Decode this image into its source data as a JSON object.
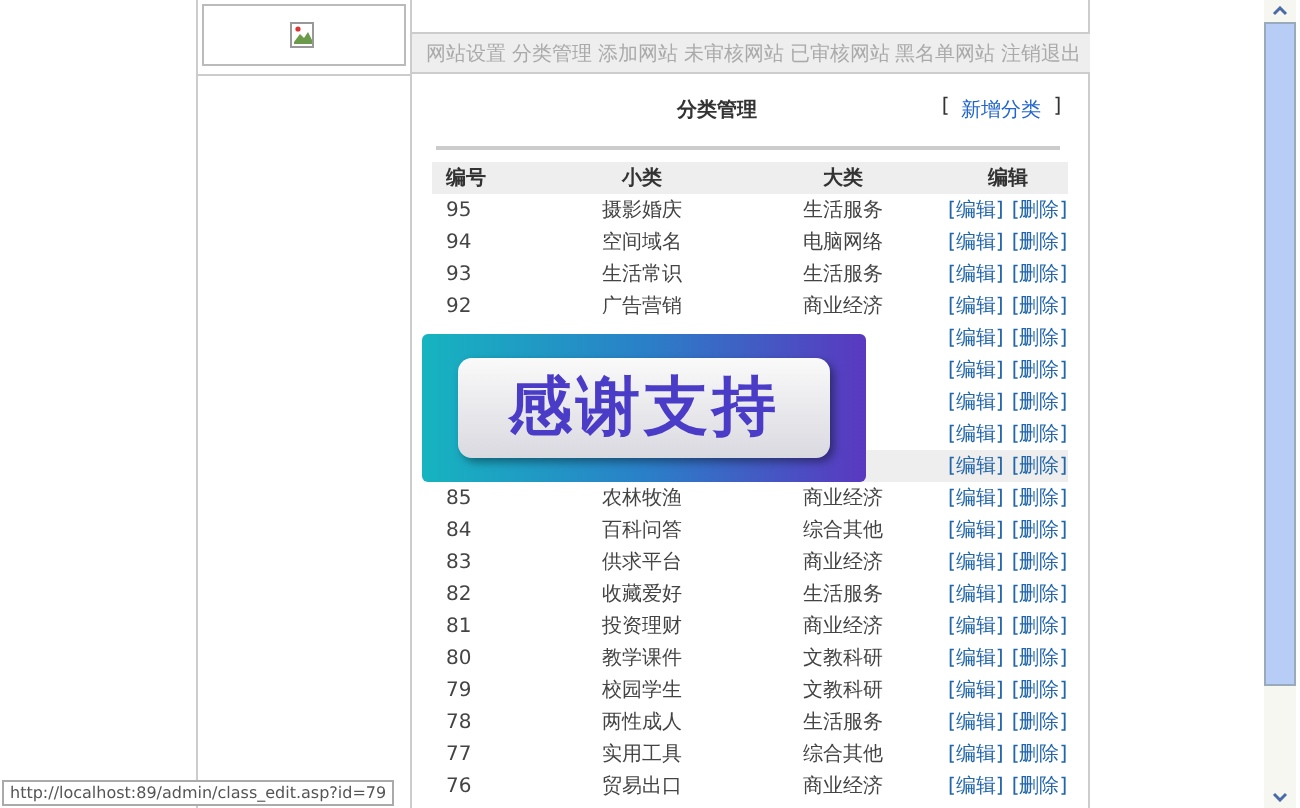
{
  "nav": [
    "网站设置",
    "分类管理",
    "添加网站",
    "未审核网站",
    "已审核网站",
    "黑名单网站",
    "注销退出"
  ],
  "title": "分类管理",
  "add_link": {
    "open": "[",
    "label": "新增分类",
    "close": "]"
  },
  "table": {
    "columns": [
      "编号",
      "小类",
      "大类",
      "编辑"
    ],
    "rows": [
      {
        "id": "95",
        "sub": "摄影婚庆",
        "cat": "生活服务",
        "edit": "[编辑]",
        "delete": "[删除]",
        "selected": false
      },
      {
        "id": "94",
        "sub": "空间域名",
        "cat": "电脑网络",
        "edit": "[编辑]",
        "delete": "[删除]",
        "selected": false
      },
      {
        "id": "93",
        "sub": "生活常识",
        "cat": "生活服务",
        "edit": "[编辑]",
        "delete": "[删除]",
        "selected": false
      },
      {
        "id": "92",
        "sub": "广告营销",
        "cat": "商业经济",
        "edit": "[编辑]",
        "delete": "[删除]",
        "selected": false
      },
      {
        "edit": "[编辑]",
        "delete": "[删除]",
        "selected": false
      },
      {
        "edit": "[编辑]",
        "delete": "[删除]",
        "selected": false
      },
      {
        "edit": "[编辑]",
        "delete": "[删除]",
        "selected": false
      },
      {
        "edit": "[编辑]",
        "delete": "[删除]",
        "selected": false
      },
      {
        "edit": "[编辑]",
        "delete": "[删除]",
        "selected": true
      },
      {
        "id": "85",
        "sub": "农林牧渔",
        "cat": "商业经济",
        "edit": "[编辑]",
        "delete": "[删除]",
        "selected": false
      },
      {
        "id": "84",
        "sub": "百科问答",
        "cat": "综合其他",
        "edit": "[编辑]",
        "delete": "[删除]",
        "selected": false
      },
      {
        "id": "83",
        "sub": "供求平台",
        "cat": "商业经济",
        "edit": "[编辑]",
        "delete": "[删除]",
        "selected": false
      },
      {
        "id": "82",
        "sub": "收藏爱好",
        "cat": "生活服务",
        "edit": "[编辑]",
        "delete": "[删除]",
        "selected": false
      },
      {
        "id": "81",
        "sub": "投资理财",
        "cat": "商业经济",
        "edit": "[编辑]",
        "delete": "[删除]",
        "selected": false
      },
      {
        "id": "80",
        "sub": "教学课件",
        "cat": "文教科研",
        "edit": "[编辑]",
        "delete": "[删除]",
        "selected": false
      },
      {
        "id": "79",
        "sub": "校园学生",
        "cat": "文教科研",
        "edit": "[编辑]",
        "delete": "[删除]",
        "selected": false
      },
      {
        "id": "78",
        "sub": "两性成人",
        "cat": "生活服务",
        "edit": "[编辑]",
        "delete": "[删除]",
        "selected": false
      },
      {
        "id": "77",
        "sub": "实用工具",
        "cat": "综合其他",
        "edit": "[编辑]",
        "delete": "[删除]",
        "selected": false
      },
      {
        "id": "76",
        "sub": "贸易出口",
        "cat": "商业经济",
        "edit": "[编辑]",
        "delete": "[删除]",
        "selected": false
      }
    ]
  },
  "banner": {
    "text": "感谢支持"
  },
  "status_url": "http://localhost:89/admin/class_edit.asp?id=79"
}
